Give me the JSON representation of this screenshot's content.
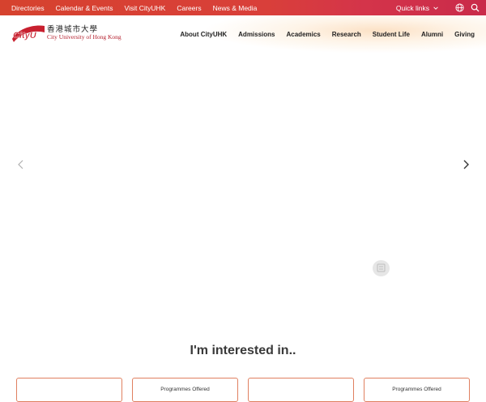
{
  "topbar": {
    "links": [
      "Directories",
      "Calendar & Events",
      "Visit CityUHK",
      "Careers",
      "News & Media"
    ],
    "quick_links": "Quick links"
  },
  "logo": {
    "mark": "CityU",
    "chinese": "香港城市大學",
    "english": "City University of Hong Kong"
  },
  "mainnav": {
    "items": [
      "About CityUHK",
      "Admissions",
      "Academics",
      "Research",
      "Student Life",
      "Alumni",
      "Giving"
    ]
  },
  "hero": {
    "prev_icon": "chevron-left-icon",
    "next_icon": "chevron-right-icon"
  },
  "interest": {
    "heading": "I'm interested in..",
    "cards": [
      "",
      "Programmes Offered",
      "",
      "Programmes Offered"
    ]
  },
  "colors": {
    "brand_red": "#d6422e",
    "logo_red": "#b5202e",
    "card_border": "#e08060"
  }
}
